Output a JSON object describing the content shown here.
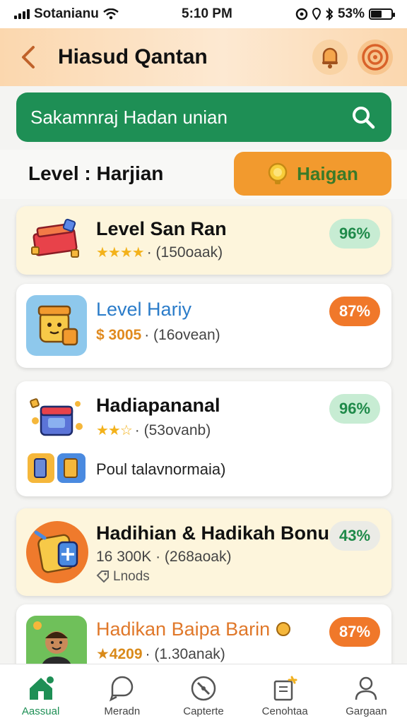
{
  "status_bar": {
    "carrier": "Sotanianu",
    "time": "5:10 PM",
    "battery": "53%",
    "battery_level": 0.53
  },
  "header": {
    "back_icon": "chevron-left-icon",
    "title": "Hiasud Qantan",
    "notification_icon": "bell-icon",
    "target_icon": "target-icon"
  },
  "search": {
    "text": "Sakamnraj Hadan unian",
    "icon": "search-icon"
  },
  "filter": {
    "level_label": "Level : Harjian",
    "action_label": "Haigan",
    "action_icon": "coin-icon"
  },
  "cards": [
    {
      "title": "Level San Ran",
      "stars": "★★★★",
      "sub": "· (150oaak)",
      "badge": "96%",
      "badge_color": "#1f8a4a"
    },
    {
      "title": "Level Hariy",
      "price": "$ 3005",
      "sub": "· (16ovean)",
      "badge": "87%",
      "badge_color": "#f0782a"
    },
    {
      "title": "Hadiapananal",
      "stars": "★★☆",
      "sub": "· (53ovanb)",
      "badge": "96%",
      "badge_color": "#1f8a4a",
      "extra": "Poul talavnormaia)"
    },
    {
      "title": "Hadihian & Hadikah Bonus",
      "sub": "16 300K · (268aoak)",
      "note": "Lnods",
      "badge": "43%",
      "badge_color": "#1f8a4a"
    },
    {
      "title": "Hadikan Baipa Barin",
      "price": "★4209",
      "sub": "· (1.30anak)",
      "badge": "87%",
      "badge_color": "#f0782a"
    }
  ],
  "nav": [
    {
      "label": "Aassual",
      "icon": "home-icon"
    },
    {
      "label": "Meradn",
      "icon": "chat-icon"
    },
    {
      "label": "Capterte",
      "icon": "compass-icon"
    },
    {
      "label": "Cenohtaa",
      "icon": "clipboard-icon"
    },
    {
      "label": "Gargaan",
      "icon": "user-icon"
    }
  ]
}
